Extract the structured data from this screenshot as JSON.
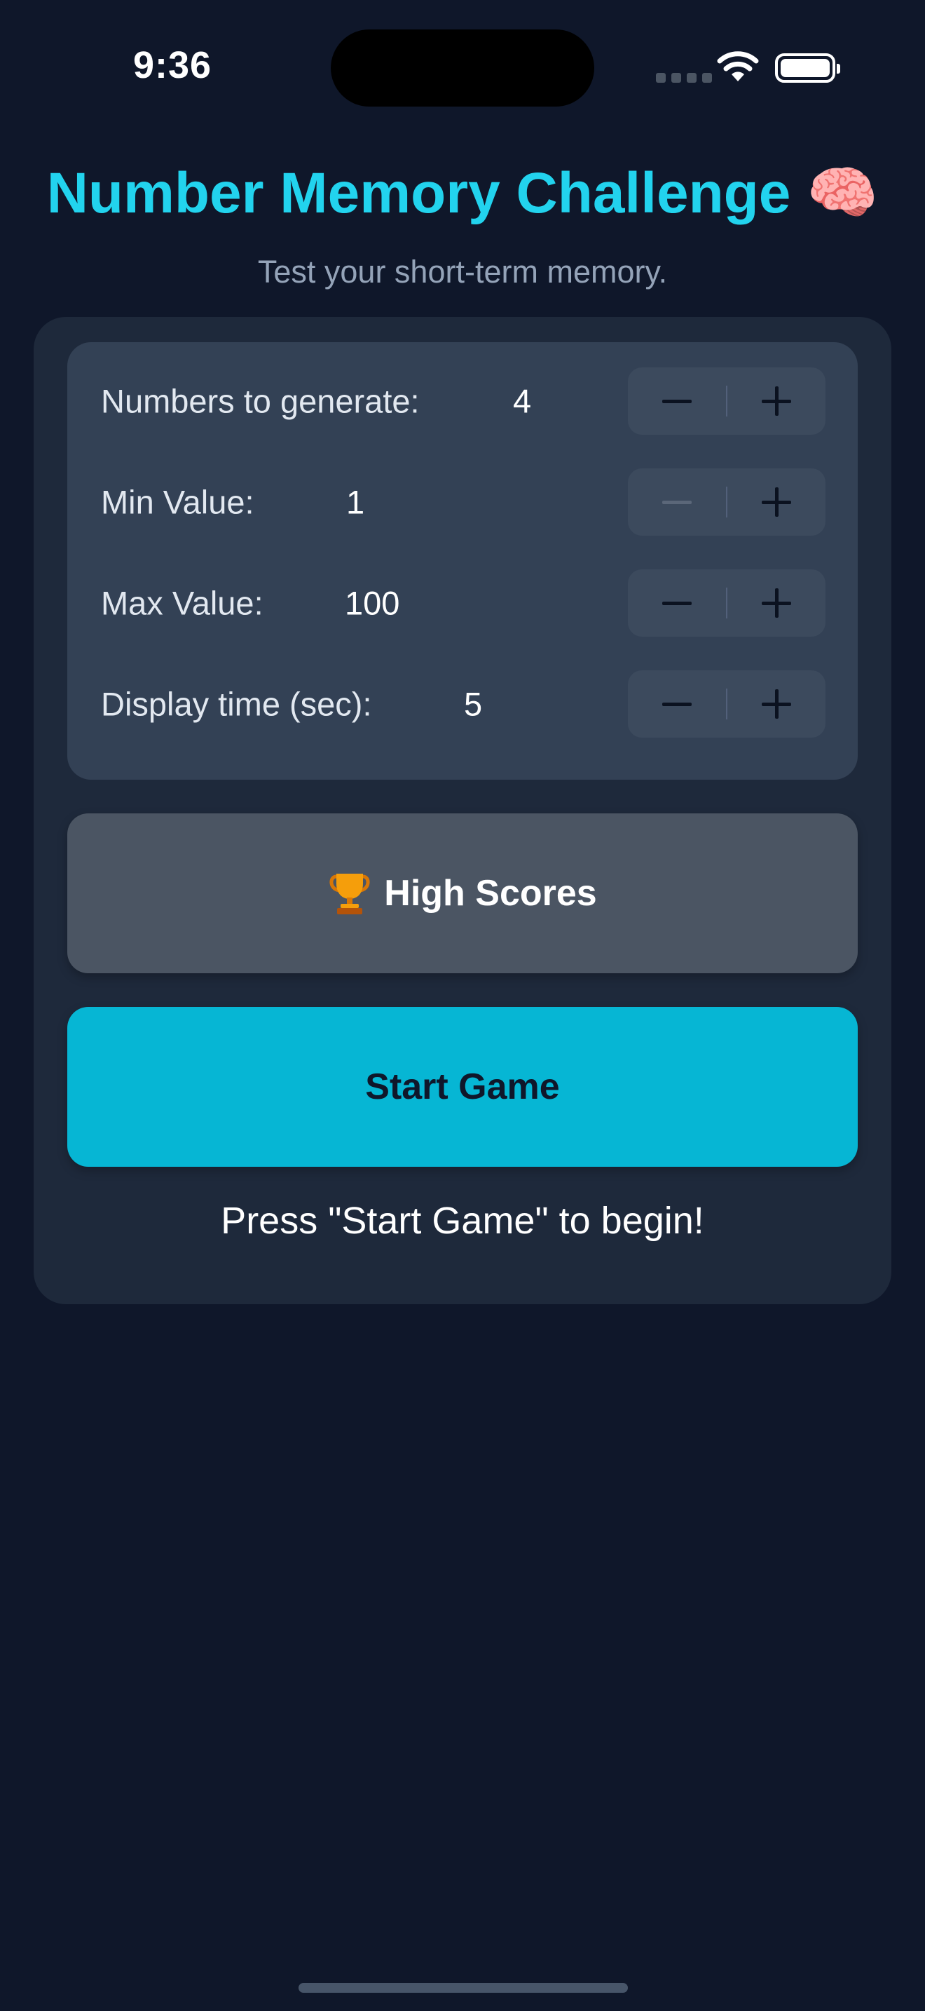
{
  "status_bar": {
    "time": "9:36",
    "icons": [
      "signal-icon",
      "wifi-icon",
      "battery-icon"
    ]
  },
  "header": {
    "title": "Number Memory Challenge",
    "title_emoji": "🧠",
    "subtitle": "Test your short-term memory."
  },
  "settings": [
    {
      "label": "Numbers to generate:",
      "value": "4",
      "minus_enabled": true,
      "plus_enabled": true
    },
    {
      "label": "Min Value:",
      "value": "1",
      "minus_enabled": false,
      "plus_enabled": true
    },
    {
      "label": "Max Value:",
      "value": "100",
      "minus_enabled": true,
      "plus_enabled": true
    },
    {
      "label": "Display time (sec):",
      "value": "5",
      "minus_enabled": true,
      "plus_enabled": true
    }
  ],
  "buttons": {
    "high_scores_label": "High Scores",
    "start_game_label": "Start Game"
  },
  "prompt": "Press \"Start Game\" to begin!",
  "colors": {
    "background": "#0f172a",
    "card": "#1e293b",
    "panel": "#334155",
    "accent": "#22d3ee",
    "primary_button": "#06b6d4",
    "secondary_button": "#4b5563"
  }
}
